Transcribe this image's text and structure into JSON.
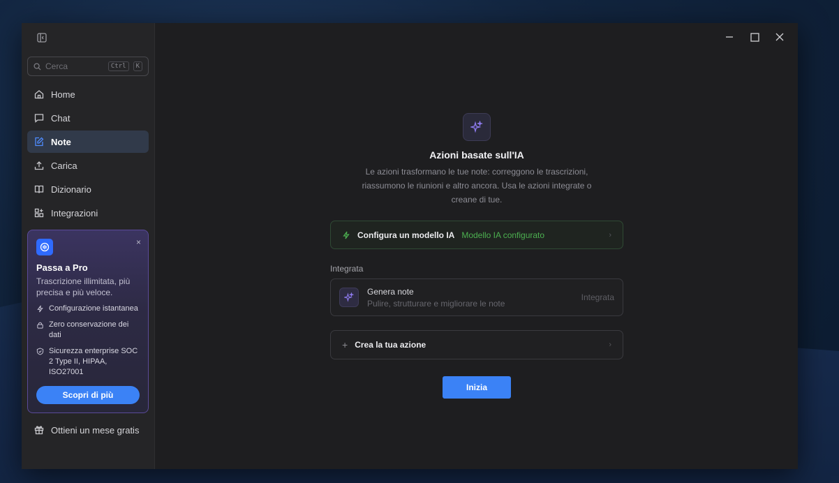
{
  "search": {
    "placeholder": "Cerca",
    "kbd_ctrl": "Ctrl",
    "kbd_k": "K"
  },
  "sidebar": {
    "items": [
      {
        "label": "Home",
        "icon": "home-icon"
      },
      {
        "label": "Chat",
        "icon": "chat-icon"
      },
      {
        "label": "Note",
        "icon": "note-edit-icon",
        "active": true
      },
      {
        "label": "Carica",
        "icon": "upload-icon"
      },
      {
        "label": "Dizionario",
        "icon": "book-icon"
      },
      {
        "label": "Integrazioni",
        "icon": "grid-plus-icon"
      }
    ],
    "gift_label": "Ottieni un mese gratis"
  },
  "pro": {
    "close": "×",
    "title": "Passa a Pro",
    "subtitle": "Trascrizione illimitata, più precisa e più veloce.",
    "features": [
      "Configurazione istantanea",
      "Zero conservazione dei dati",
      "Sicurezza enterprise SOC 2 Type II, HIPAA, ISO27001"
    ],
    "button": "Scopri di più"
  },
  "main": {
    "title": "Azioni basate sull'IA",
    "description": "Le azioni trasformano le tue note: correggono le trascrizioni, riassumono le riunioni e altro ancora. Usa le azioni integrate o creane di tue.",
    "model_card": {
      "label": "Configura un modello IA",
      "status": "Modello IA configurato",
      "chevron": "›"
    },
    "section_label": "Integrata",
    "generate": {
      "name": "Genera note",
      "desc": "Pulire, strutturare e migliorare le note",
      "tag": "Integrata"
    },
    "create": {
      "plus": "+",
      "label": "Crea la tua azione",
      "chevron": "›"
    },
    "start_button": "Inizia"
  },
  "colors": {
    "accent": "#3b82f6",
    "success": "#4cb050",
    "pro_border": "#5a4a9a"
  }
}
